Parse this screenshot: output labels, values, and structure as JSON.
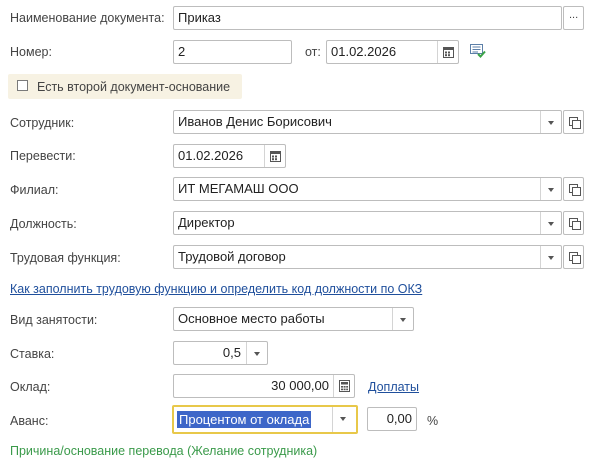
{
  "form": {
    "doc_name_label": "Наименование документа:",
    "doc_name_value": "Приказ",
    "doc_name_more": "...",
    "number_label": "Номер:",
    "number_value": "2",
    "from_label": "от:",
    "date_value": "01.02.2026",
    "second_doc_label": "Есть второй документ-основание",
    "employee_label": "Сотрудник:",
    "employee_value": "Иванов Денис Борисович",
    "transfer_label": "Перевести:",
    "transfer_value": "01.02.2026",
    "branch_label": "Филиал:",
    "branch_value": "ИТ МЕГАМАШ ООО",
    "position_label": "Должность:",
    "position_value": "Директор",
    "labor_func_label": "Трудовая функция:",
    "labor_func_value": "Трудовой договор",
    "okz_link": "Как заполнить трудовую функцию и определить код должности по ОКЗ",
    "employment_label": "Вид занятости:",
    "employment_value": "Основное место работы",
    "rate_label": "Ставка:",
    "rate_value": "0,5",
    "salary_label": "Оклад:",
    "salary_value": "30 000,00",
    "allowances_link": "Доплаты",
    "advance_label": "Аванс:",
    "advance_value": "Процентом от оклада",
    "advance_percent_value": "0,00",
    "percent_sign": "%",
    "reason_link": "Причина/основание перевода (Желание сотрудника)"
  },
  "colors": {
    "accent_focus": "#e8c84a",
    "selection": "#3d66c8",
    "link": "#1f4f9c",
    "green_link": "#3a9a4a",
    "checkbox_panel": "#f7f2e3"
  },
  "icons": [
    "more-icon",
    "calendar-icon",
    "green-list-icon",
    "chevron-down-icon",
    "open-item-icon"
  ]
}
